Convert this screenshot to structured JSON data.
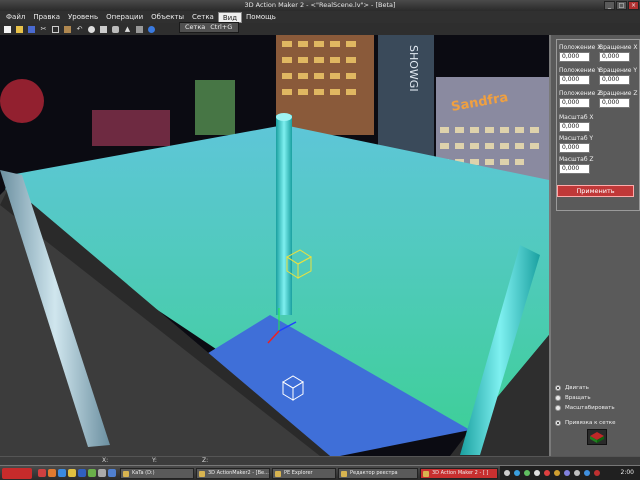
{
  "window": {
    "title": "3D Action Maker 2 - <\"RealScene.lv\"> - [Beta]"
  },
  "menu": [
    "Файл",
    "Правка",
    "Уровень",
    "Операции",
    "Объекты",
    "Сетка",
    "Вид",
    "Помощь"
  ],
  "menu_active_index": 6,
  "dropdown": {
    "item_label": "Сетка",
    "item_shortcut": "Ctrl+G"
  },
  "toolbar_icons": [
    "new-file-icon",
    "open-folder-icon",
    "save-icon",
    "cut-icon",
    "copy-icon",
    "paste-icon",
    "undo-icon",
    "sphere-icon",
    "box-icon",
    "cylinder-icon",
    "cone-icon",
    "trash-icon",
    "info-icon"
  ],
  "props": {
    "pos_x_label": "Положение X",
    "rot_x_label": "Вращение X",
    "pos_x": "0,000",
    "rot_x": "0,000",
    "pos_y_label": "Положение Y",
    "rot_y_label": "Вращение Y",
    "pos_y": "0,000",
    "rot_y": "0,000",
    "pos_z_label": "Положение Z",
    "rot_z_label": "Вращение Z",
    "pos_z": "0,000",
    "rot_z": "0,000",
    "scale_x_label": "Масштаб X",
    "scale_x": "0,000",
    "scale_y_label": "Масштаб Y",
    "scale_y": "0,000",
    "scale_z_label": "Масштаб Z",
    "scale_z": "0,000",
    "apply_label": "Применить"
  },
  "modes": {
    "move": "Двигать",
    "rotate": "Вращать",
    "scale": "Масштабировать",
    "snap": "Привязка к сетке",
    "selected": "move"
  },
  "statusbar": {
    "x": "X:",
    "y": "Y:",
    "z": "Z:"
  },
  "taskbar": {
    "tasks": [
      "KaTa (D:)",
      "3D ActionMaker2 - [Be...",
      "PE Explorer",
      "Редактор реестра",
      "3D Action Maker 2 - [ ]"
    ],
    "active_task": 4,
    "clock": "2:00"
  },
  "viewport_texts": {
    "sign": "SHOWGI",
    "sign2": "Sandfra"
  },
  "colors": {
    "accent": "#c03838",
    "water": "#4fc8b8",
    "floor": "#3f6fd8"
  }
}
